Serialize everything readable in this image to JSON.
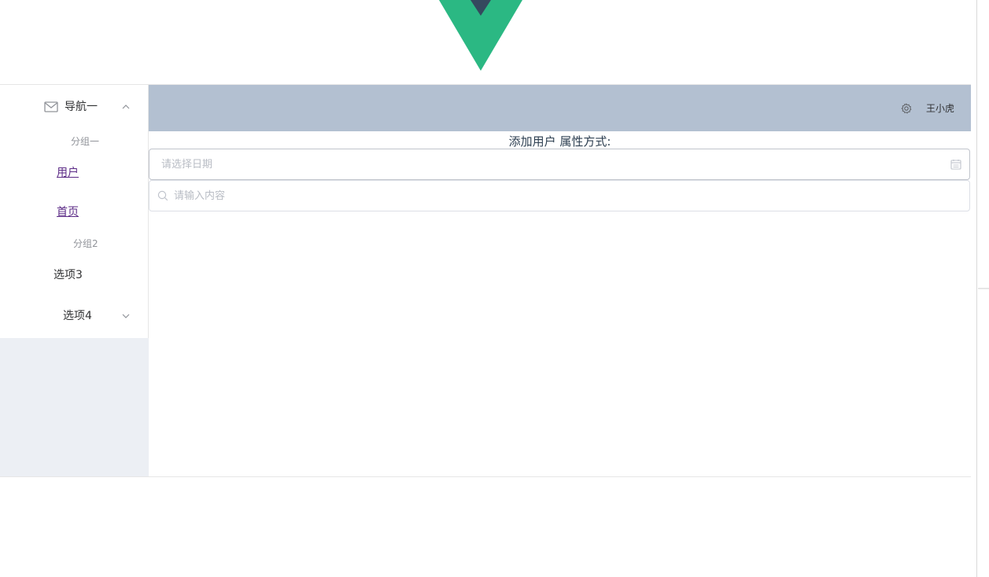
{
  "header": {
    "username": "王小虎"
  },
  "menu": {
    "nav1": {
      "label": "导航一"
    },
    "group1": {
      "label": "分组一"
    },
    "items": [
      {
        "label": "用户"
      },
      {
        "label": "首页"
      }
    ],
    "group2": {
      "label": "分组2"
    },
    "option3": {
      "label": "选项3"
    },
    "option4": {
      "label": "选项4"
    }
  },
  "main": {
    "form_title": "添加用户 属性方式:",
    "date_input": {
      "placeholder": "请选择日期",
      "value": ""
    },
    "search_input": {
      "placeholder": "请输入内容",
      "value": ""
    }
  },
  "icons": {
    "logo": "vue-logo-icon",
    "nav1": "message-icon",
    "nav1_arrow": "chevron-up-icon",
    "option4_arrow": "chevron-down-icon",
    "settings": "gear-icon",
    "date": "calendar-icon",
    "search": "search-icon"
  },
  "colors": {
    "header_bg": "#b3c0d1",
    "aside_bg": "#eceff4",
    "logo_green": "#2bb883",
    "logo_dark": "#35495e",
    "link": "#5b2a86"
  }
}
